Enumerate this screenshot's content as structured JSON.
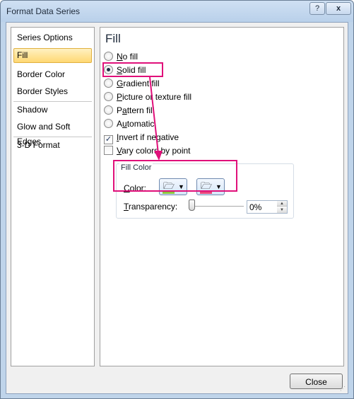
{
  "window": {
    "title": "Format Data Series",
    "help_label": "?",
    "close_label": "x"
  },
  "nav": {
    "items": [
      {
        "label": "Series Options",
        "selected": false
      },
      {
        "label": "Fill",
        "selected": true
      },
      {
        "label": "Border Color",
        "selected": false
      },
      {
        "label": "Border Styles",
        "selected": false
      },
      {
        "label": "Shadow",
        "selected": false
      },
      {
        "label": "Glow and Soft Edges",
        "selected": false
      },
      {
        "label": "3-D Format",
        "selected": false
      }
    ]
  },
  "panel": {
    "title": "Fill",
    "fill_options": [
      {
        "label": "No fill",
        "accel": "N",
        "selected": false
      },
      {
        "label": "Solid fill",
        "accel": "S",
        "selected": true
      },
      {
        "label": "Gradient fill",
        "accel": "G",
        "selected": false
      },
      {
        "label": "Picture or texture fill",
        "accel": "P",
        "selected": false
      },
      {
        "label": "Pattern fill",
        "accel": "a",
        "selected": false
      },
      {
        "label": "Automatic",
        "accel": "u",
        "selected": false
      }
    ],
    "checkboxes": [
      {
        "label": "Invert if negative",
        "accel": "I",
        "checked": true
      },
      {
        "label": "Vary colors by point",
        "accel": "V",
        "checked": false
      }
    ],
    "fill_color": {
      "group_label": "Fill Color",
      "color_label": "Color:",
      "color_accel": "C",
      "color_button_swatch": "#8dc63f",
      "second_button_swatch": "#e8457a",
      "transparency_label": "Transparency:",
      "transparency_accel": "T",
      "transparency_value": "0%",
      "transparency_percent": 0
    }
  },
  "footer": {
    "close_label": "Close"
  },
  "annotation": {
    "color": "#e0107a"
  }
}
